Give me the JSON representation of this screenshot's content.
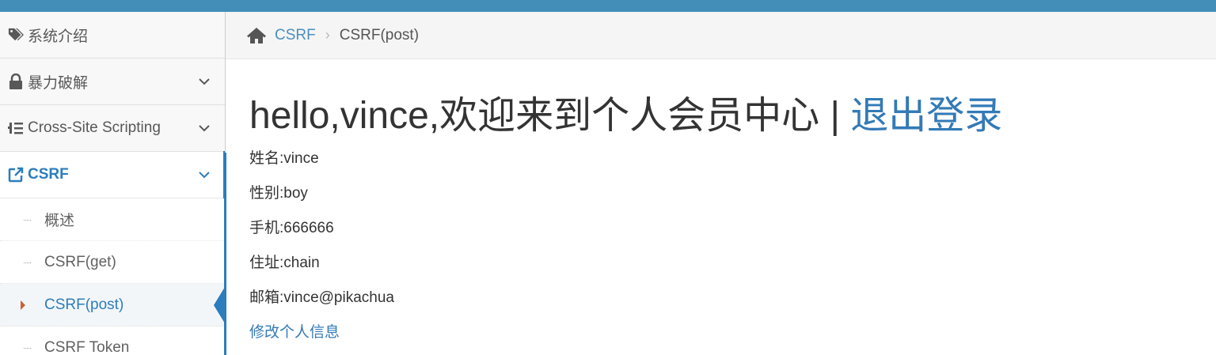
{
  "sidebar": {
    "items": [
      {
        "label": "系统介绍",
        "icon": "tags-icon"
      },
      {
        "label": "暴力破解",
        "icon": "lock-icon"
      },
      {
        "label": "Cross-Site Scripting",
        "icon": "list-tree-icon"
      },
      {
        "label": "CSRF",
        "icon": "share-icon"
      }
    ],
    "csrf_submenu": [
      {
        "label": "概述"
      },
      {
        "label": "CSRF(get)"
      },
      {
        "label": "CSRF(post)"
      },
      {
        "label": "CSRF Token"
      }
    ]
  },
  "breadcrumb": {
    "home_icon": "home-icon",
    "parent": "CSRF",
    "separator": "›",
    "current": "CSRF(post)"
  },
  "main": {
    "greeting": "hello,vince,欢迎来到个人会员中心",
    "divider": " | ",
    "logout": "退出登录",
    "fields": [
      "姓名:vince",
      "性别:boy",
      "手机:666666",
      "住址:chain",
      "邮箱:vince@pikachua"
    ],
    "edit_link": "修改个人信息"
  },
  "colors": {
    "topbar": "#438eb9",
    "accent": "#2b7dbc",
    "link": "#337ab7"
  }
}
